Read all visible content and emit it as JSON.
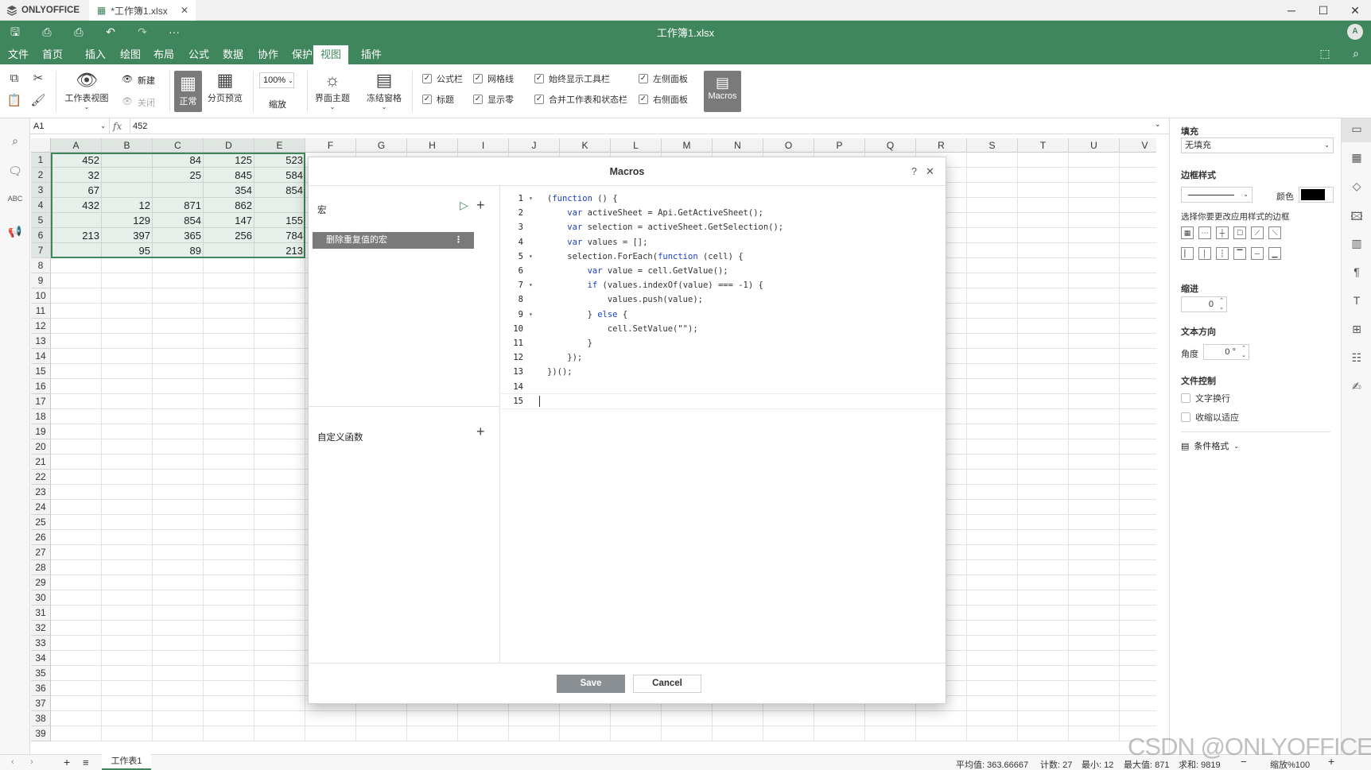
{
  "app": {
    "brand": "ONLYOFFICE",
    "file_tab": "*工作簿1.xlsx",
    "doc_title": "工作簿1.xlsx",
    "avatar": "A"
  },
  "menu": [
    "文件",
    "首页",
    "插入",
    "绘图",
    "布局",
    "公式",
    "数据",
    "协作",
    "保护",
    "视图",
    "插件"
  ],
  "active_menu_index": 9,
  "toolbar": {
    "sheet_view": "工作表视图",
    "new": "新建",
    "close": "关闭",
    "normal": "正常",
    "page_break": "分页预览",
    "zoom_value": "100%",
    "zoom_label": "缩放",
    "theme": "界面主题",
    "freeze": "冻结窗格",
    "checks": [
      {
        "label": "公式栏",
        "checked": true
      },
      {
        "label": "网格线",
        "checked": true
      },
      {
        "label": "始终显示工具栏",
        "checked": true
      },
      {
        "label": "左侧面板",
        "checked": true
      },
      {
        "label": "标题",
        "checked": true
      },
      {
        "label": "显示零",
        "checked": true
      },
      {
        "label": "合并工作表和状态栏",
        "checked": true
      },
      {
        "label": "右侧面板",
        "checked": true
      }
    ],
    "macros": "Macros"
  },
  "formula": {
    "cell_ref": "A1",
    "fx": "fx",
    "value": "452"
  },
  "sheet": {
    "columns": [
      "A",
      "B",
      "C",
      "D",
      "E",
      "F",
      "G",
      "H",
      "I",
      "J",
      "K",
      "L",
      "M",
      "N",
      "O",
      "P",
      "Q",
      "R",
      "S",
      "T",
      "U",
      "V"
    ],
    "rows": [
      "1",
      "2",
      "3",
      "4",
      "5",
      "6",
      "7",
      "8",
      "9",
      "10",
      "11",
      "12",
      "13",
      "14",
      "15",
      "16",
      "17",
      "18",
      "19",
      "20",
      "21",
      "22",
      "23",
      "24",
      "25",
      "26",
      "27",
      "28",
      "29",
      "30",
      "31",
      "32",
      "33",
      "34",
      "35",
      "36",
      "37",
      "38",
      "39"
    ],
    "data": [
      [
        "452",
        "",
        "84",
        "125",
        "523"
      ],
      [
        "32",
        "",
        "25",
        "845",
        "584"
      ],
      [
        "67",
        "",
        "",
        "354",
        "854"
      ],
      [
        "432",
        "12",
        "871",
        "862",
        ""
      ],
      [
        "",
        "129",
        "854",
        "147",
        "155"
      ],
      [
        "213",
        "397",
        "365",
        "256",
        "784"
      ],
      [
        "",
        "95",
        "89",
        "",
        "213"
      ]
    ]
  },
  "dialog": {
    "title": "Macros",
    "help": "?",
    "macros_header": "宏",
    "macro_item": "删除重复值的宏",
    "custom_functions": "自定义函数",
    "code_lines": [
      "(function () {",
      "    var activeSheet = Api.GetActiveSheet();",
      "    var selection = activeSheet.GetSelection();",
      "    var values = [];",
      "    selection.ForEach(function (cell) {",
      "        var value = cell.GetValue();",
      "        if (values.indexOf(value) === -1) {",
      "            values.push(value);",
      "        } else {",
      "            cell.SetValue(\"\");",
      "        }",
      "    });",
      "})();",
      "",
      ""
    ],
    "save": "Save",
    "cancel": "Cancel"
  },
  "right_panel": {
    "fill": "填充",
    "fill_value": "无填充",
    "border_style": "边框样式",
    "color": "颜色",
    "border_hint": "选择你要更改应用样式的边框",
    "indent": "缩进",
    "indent_value": "0",
    "text_direction": "文本方向",
    "angle": "角度",
    "angle_value": "0 °",
    "text_control": "文件控制",
    "wrap": "文字换行",
    "shrink": "收缩以适应",
    "cond_format": "条件格式"
  },
  "status": {
    "sheet_tab": "工作表1",
    "avg": "平均值: 363.66667",
    "count": "计数: 27",
    "min": "最小: 12",
    "max": "最大值: 871",
    "sum": "求和: 9819",
    "zoom": "缩放%100",
    "watermark": "CSDN @ONLYOFFICE"
  },
  "colors": {
    "brand": "#40865c",
    "macros_btn": "#7a7a7a",
    "save_btn": "#8a8f94"
  }
}
